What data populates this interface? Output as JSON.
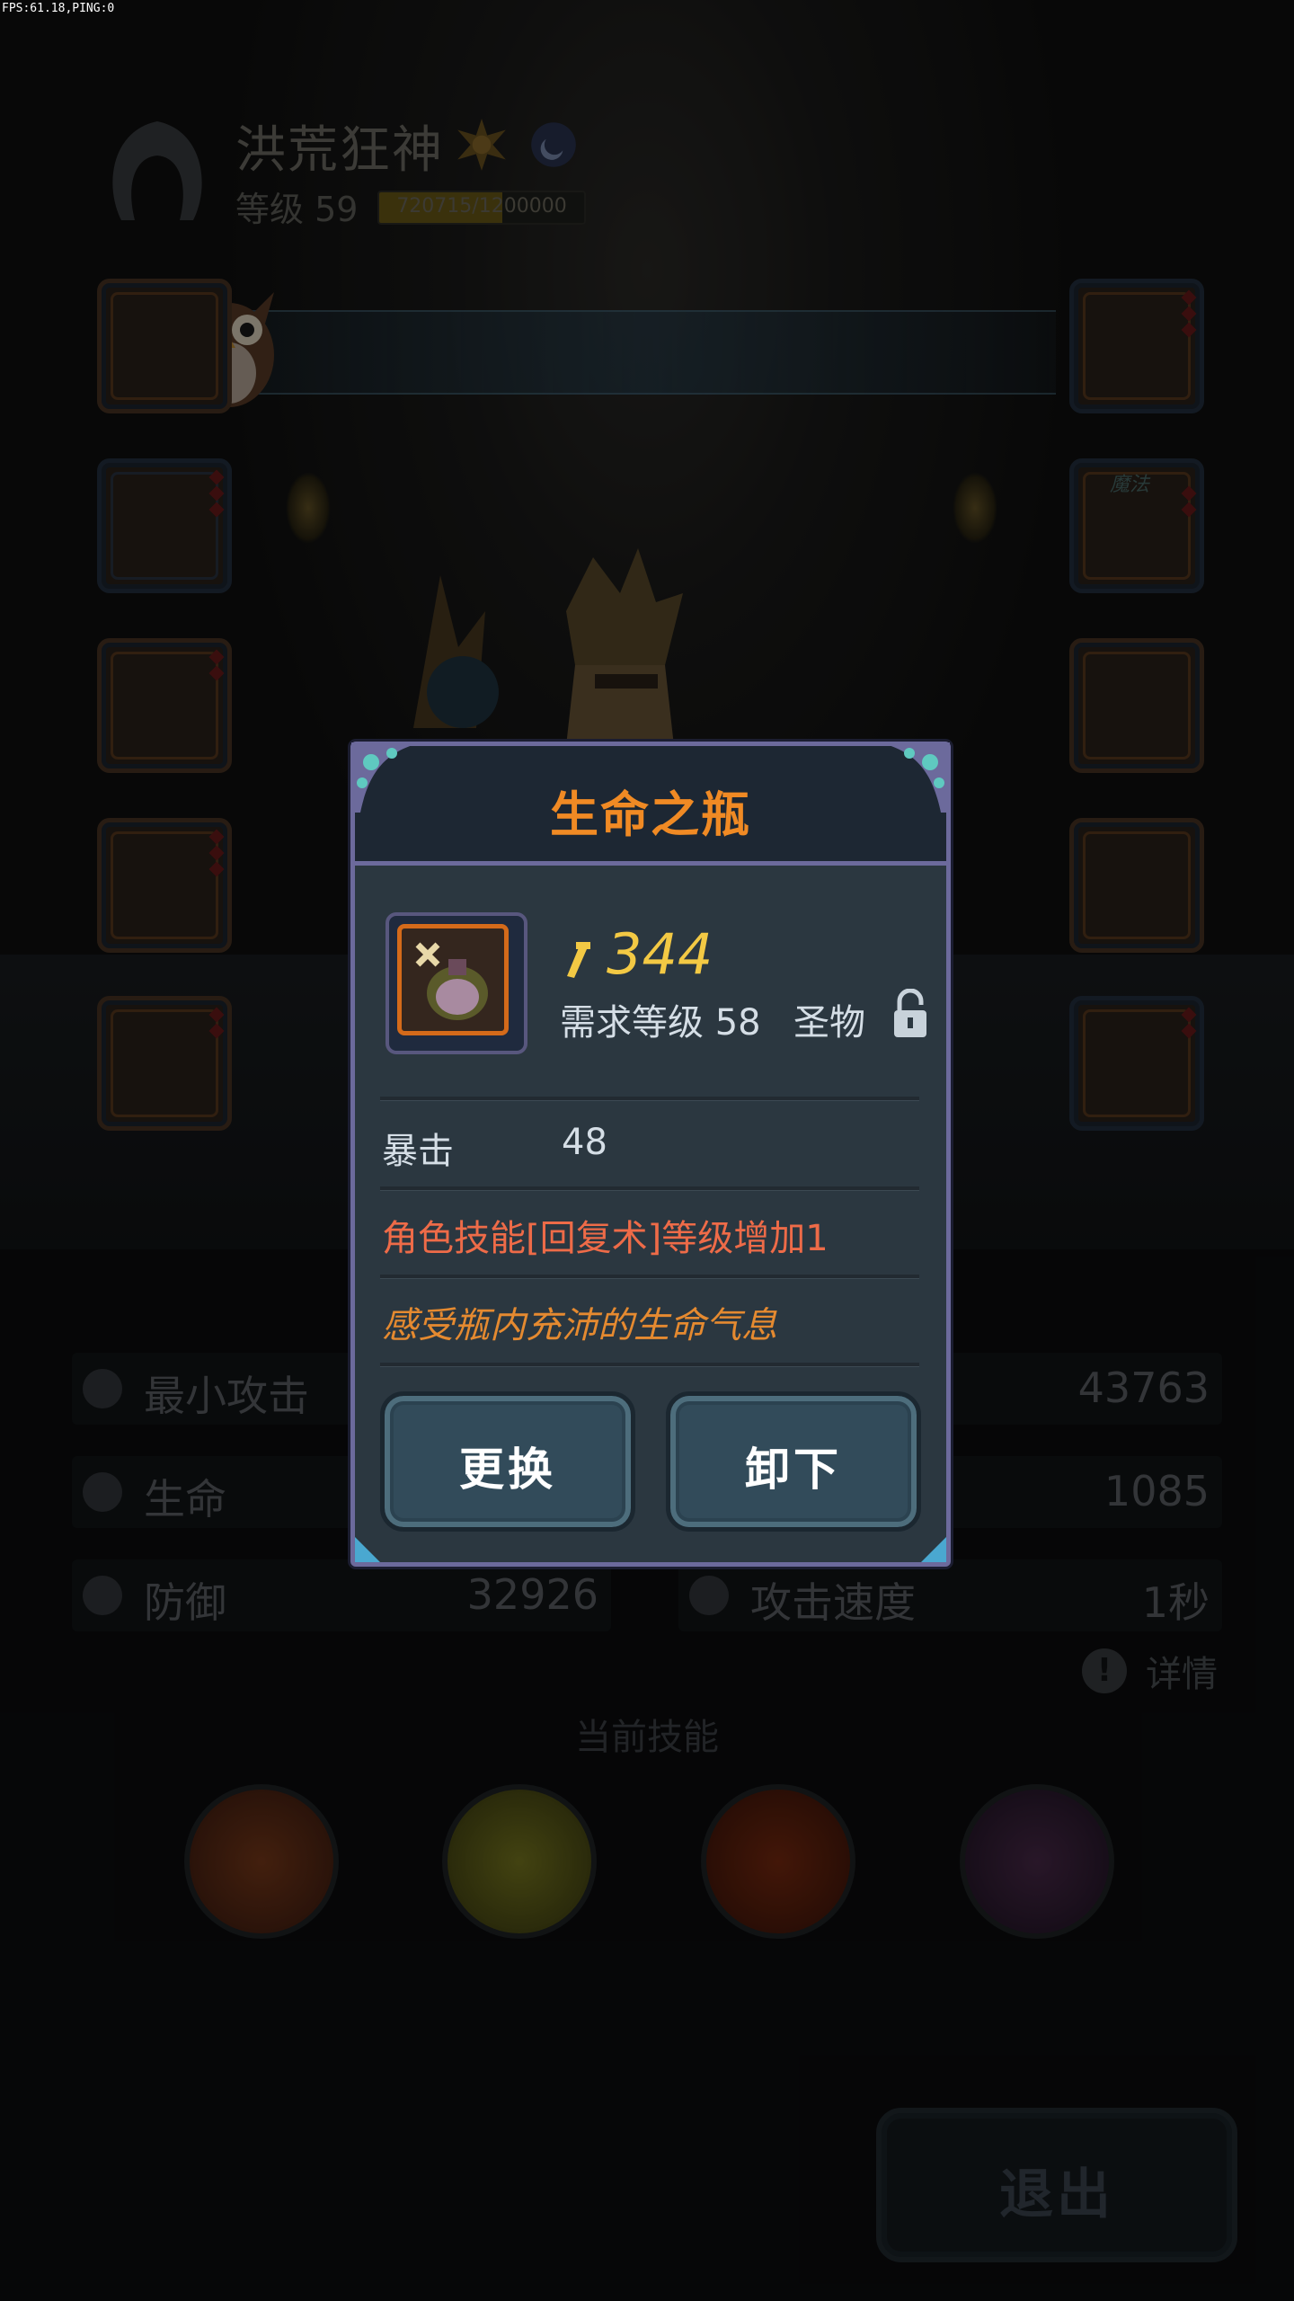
{
  "debug": {
    "fps": "FPS:61.18,PING:0"
  },
  "player": {
    "name": "洪荒狂神",
    "level_label": "等级 59",
    "exp_text": "720715/1200000",
    "exp_fraction": 0.6
  },
  "equipment": {
    "left_slots": [
      "helmet",
      "armor",
      "boots",
      "gauntlet",
      "belt"
    ],
    "right_slots": [
      "weapon",
      "ring",
      "necklace",
      "amulet",
      "relic"
    ],
    "ring_tag": "魔法"
  },
  "stats": [
    {
      "label": "最小攻击",
      "value": "43763",
      "icon": "sword-icon"
    },
    {
      "label": "生命",
      "value": "1085",
      "icon": "heart-icon"
    },
    {
      "label": "防御",
      "value": "32926",
      "icon": "shield-icon"
    },
    {
      "label": "攻击速度",
      "value": "1秒",
      "icon": "speed-icon"
    }
  ],
  "details_label": "详情",
  "skills_title": "当前技能",
  "exit_label": "退出",
  "dialog": {
    "title": "生命之瓶",
    "power": "344",
    "requirement": "需求等级 58",
    "item_type": "圣物",
    "attribute": {
      "label": "暴击",
      "value": "48"
    },
    "skill_bonus": "角色技能[回复术]等级增加1",
    "flavor": "感受瓶内充沛的生命气息",
    "replace_button": "更换",
    "unequip_button": "卸下"
  },
  "colors": {
    "title_orange": "#f08a24",
    "power_gold": "#f3c944",
    "skill_red": "#ee6b48",
    "flavor_orange": "#e58a30",
    "frame_purple": "#6c6a9c"
  }
}
